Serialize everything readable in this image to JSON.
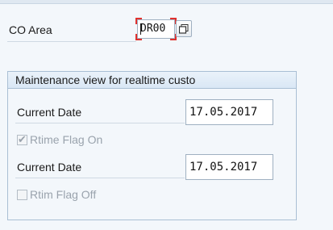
{
  "header": {
    "co_area_label": "CO Area",
    "co_area_value": "DR00"
  },
  "group": {
    "title": "Maintenance view for realtime custo",
    "rows": [
      {
        "label": "Current Date",
        "value": "17.05.2017"
      },
      {
        "label": "Rtime Flag On",
        "checked": true,
        "enabled": false
      },
      {
        "label": "Current Date",
        "value": "17.05.2017"
      },
      {
        "label": "Rtim Flag Off",
        "checked": false,
        "enabled": false
      }
    ]
  },
  "colors": {
    "focus_corner": "#e0312e",
    "group_border": "#a9bfd4",
    "background": "#f3f7fb"
  },
  "icons": {
    "f4_help": "value-help-icon"
  }
}
